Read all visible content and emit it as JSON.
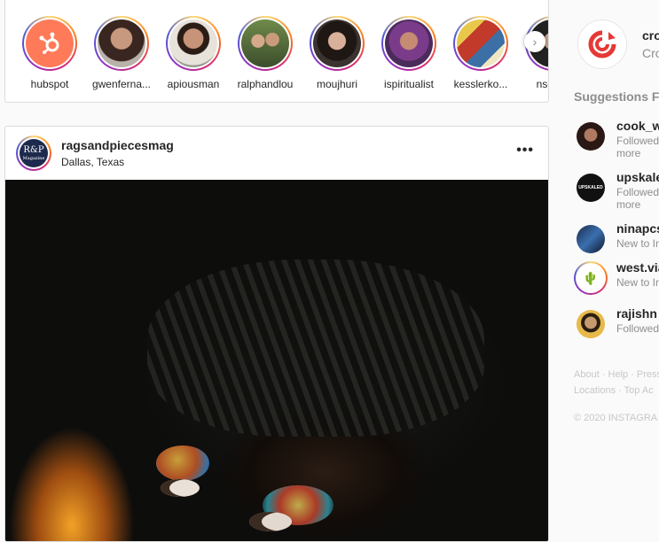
{
  "stories": [
    {
      "name": "hubspot",
      "avatar": "hubspot-logo"
    },
    {
      "name": "gwenferna...",
      "avatar": "person"
    },
    {
      "name": "apiousman",
      "avatar": "person"
    },
    {
      "name": "ralphandlou",
      "avatar": "couple"
    },
    {
      "name": "moujhuri",
      "avatar": "person"
    },
    {
      "name": "ispiritualist",
      "avatar": "person"
    },
    {
      "name": "kesslerko...",
      "avatar": "comic"
    },
    {
      "name": "nsd_pr",
      "avatar": "person"
    }
  ],
  "post": {
    "username": "ragsandpiecesmag",
    "location": "Dallas, Texas",
    "avatar_text_top": "R&P",
    "avatar_text_bottom": "Magazine",
    "more_label": "•••"
  },
  "profile": {
    "username": "cro",
    "subtitle": "Cro"
  },
  "suggestions": {
    "title": "Suggestions Fo",
    "items": [
      {
        "name": "cook_w",
        "sub1": "Followed",
        "sub2": "more"
      },
      {
        "name": "upskale",
        "sub1": "Followed",
        "sub2": "more"
      },
      {
        "name": "ninapcs",
        "sub1": "New to In",
        "sub2": ""
      },
      {
        "name": "west.via",
        "sub1": "New to In",
        "sub2": ""
      },
      {
        "name": "rajishn",
        "sub1": "Followed",
        "sub2": ""
      }
    ]
  },
  "footer": {
    "line1": "About · Help · Press",
    "line2": "Locations · Top Ac",
    "copyright": "© 2020 INSTAGRA"
  },
  "colors": {
    "hubspot": "#ff7a59",
    "brand_red": "#e53935",
    "link_gray": "#8e8e8e"
  }
}
